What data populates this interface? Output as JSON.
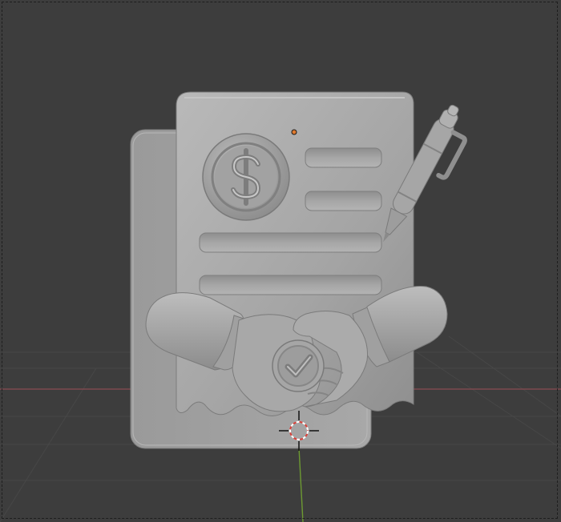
{
  "app": {
    "name": "3D Viewport",
    "view_mode": "solid-shading"
  },
  "scene": {
    "model_name": "contract-agreement-model",
    "icons": {
      "currency": "dollar-icon",
      "approval": "checkmark-icon",
      "cursor": "3d-cursor-icon",
      "origin": "object-origin-icon"
    },
    "colors": {
      "background": "#3d3d3d",
      "grid": "#4a4a4a",
      "x_axis": "#8a4b52",
      "y_axis": "#6d9a32",
      "model": "#a9a9a9",
      "model_shadow": "#8a8a8a",
      "origin": "#e07a2e",
      "cursor_ring_red": "#d9413a",
      "cursor_ring_white": "#ffffff"
    }
  }
}
